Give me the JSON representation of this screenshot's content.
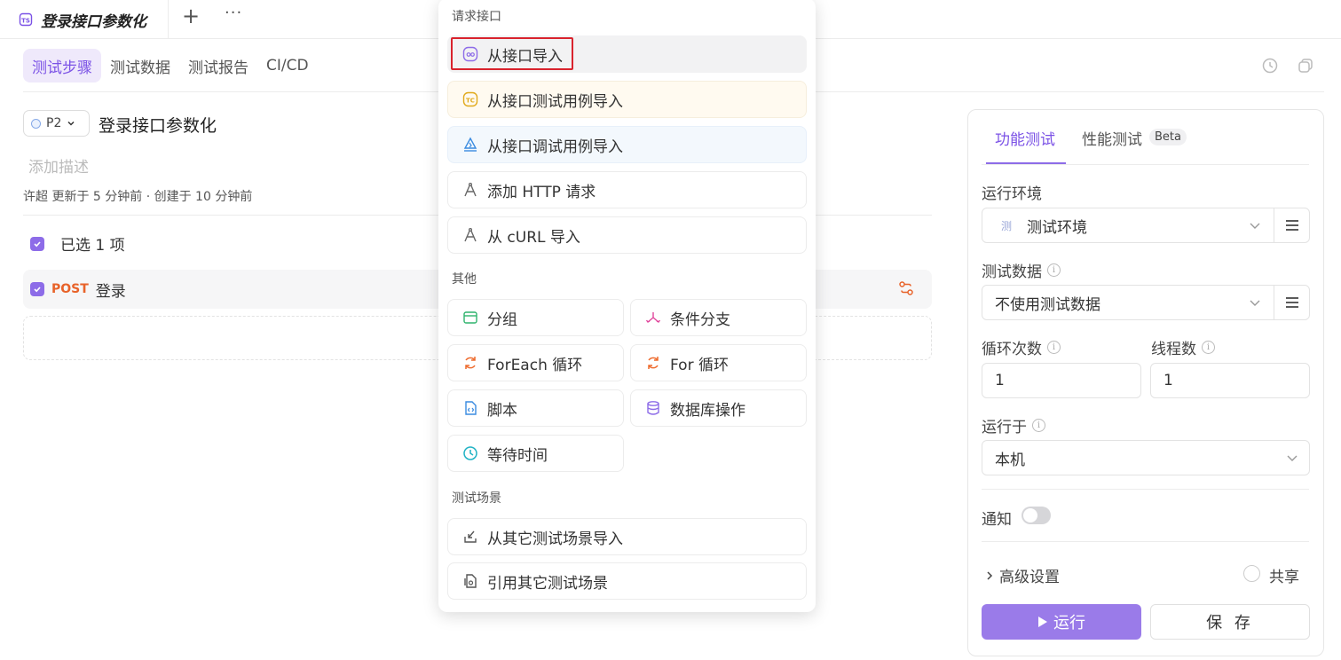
{
  "tab": {
    "title": "登录接口参数化",
    "add": "+",
    "more": "···"
  },
  "subtabs": [
    "测试步骤",
    "测试数据",
    "测试报告",
    "CI/CD"
  ],
  "case": {
    "priority": "P2",
    "title": "登录接口参数化",
    "description_placeholder": "添加描述",
    "meta": "许超 更新于 5 分钟前 · 创建于 10 分钟前",
    "selected": "已选 1 项",
    "step": {
      "method": "POST",
      "name": "登录"
    }
  },
  "panel": {
    "tab_func": "功能测试",
    "tab_perf": "性能测试",
    "beta": "Beta",
    "env_label": "运行环境",
    "env_badge": "测",
    "env_value": "测试环境",
    "data_label": "测试数据",
    "data_value": "不使用测试数据",
    "loop_label": "循环次数",
    "loop_value": "1",
    "thread_label": "线程数",
    "thread_value": "1",
    "runon_label": "运行于",
    "runon_value": "本机",
    "notify_label": "通知",
    "notify_on": false,
    "advanced": "高级设置",
    "share": "共享",
    "run": "运行",
    "save": "保 存"
  },
  "menu": {
    "section_api": "请求接口",
    "section_other": "其他",
    "section_scene": "测试场景",
    "api_items": [
      "从接口导入",
      "从接口测试用例导入",
      "从接口调试用例导入",
      "添加 HTTP 请求",
      "从 cURL 导入"
    ],
    "other_items": [
      "分组",
      "条件分支",
      "ForEach 循环",
      "For 循环",
      "脚本",
      "数据库操作",
      "等待时间"
    ],
    "scene_items": [
      "从其它测试场景导入",
      "引用其它测试场景"
    ]
  },
  "colors": {
    "accent": "#7b52e6",
    "post": "#e8632a",
    "highlight": "#d9232d"
  }
}
